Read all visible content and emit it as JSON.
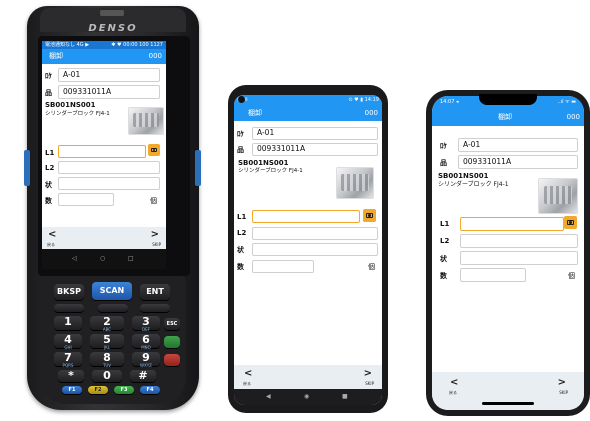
{
  "brand": "DENSO",
  "common": {
    "screen_title": "棚卸",
    "count": "000",
    "loc_label": "ﾛｹ",
    "location": "A-01",
    "item_label": "品",
    "item_code": "009331011A",
    "part_code": "SB001NS001",
    "part_name": "シリンダーブロック FJ4-1",
    "l1_label": "L1",
    "l2_label": "L2",
    "state_label": "状",
    "qty_label": "数",
    "unit": "個",
    "back_label": "戻る",
    "skip_label": "SKIP",
    "back_glyph": "<",
    "skip_glyph": ">"
  },
  "denso_status": {
    "left": "電池通知なし 4G ▶",
    "right": "✱ ♥ 00:00 100 1127"
  },
  "android_status": {
    "left": "▣ ✉",
    "right": "⊙ ♥ ▮ 14:19"
  },
  "ios_status": {
    "left": "14:07 ◂",
    "right": "..ıl ᯤ ▬"
  },
  "android_nav": {
    "back": "◀",
    "home": "◉",
    "recent": "■"
  },
  "denso_nav": {
    "back": "◁",
    "home": "○",
    "recent": "□"
  },
  "keypad": {
    "bksp": "BKSP",
    "scan": "SCAN",
    "ent": "ENT",
    "esc": "ESC",
    "f1": "F1",
    "f2": "F2",
    "f3": "F3",
    "f4": "F4",
    "keys": [
      "1",
      "2",
      "3",
      "4",
      "5",
      "6",
      "7",
      "8",
      "9",
      "*",
      "0",
      "#"
    ],
    "sub": [
      "",
      "ABC",
      "DEF",
      "GHI",
      "JKL",
      "MNO",
      "PQRS",
      "TUV",
      "WXYZ",
      "",
      "",
      ""
    ]
  },
  "colors": {
    "appbar": "#2196f3",
    "active_field": "#f0a92b",
    "scan_key": "#2a6fd0"
  }
}
